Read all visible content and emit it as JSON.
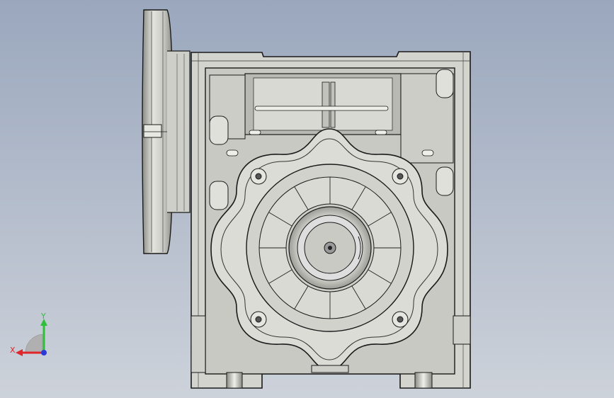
{
  "viewport": {
    "background_top": "#9aa7bd",
    "background_bottom": "#cdd2da"
  },
  "model": {
    "body_fill": "#d6d6d0",
    "shade_fill": "#b8b8b2",
    "edge_color": "#1a1a1a"
  },
  "triad": {
    "x_label": "X",
    "y_label": "Y",
    "x_color": "#e0262b",
    "y_color": "#2fbf3a",
    "z_color": "#2a3cd8"
  }
}
